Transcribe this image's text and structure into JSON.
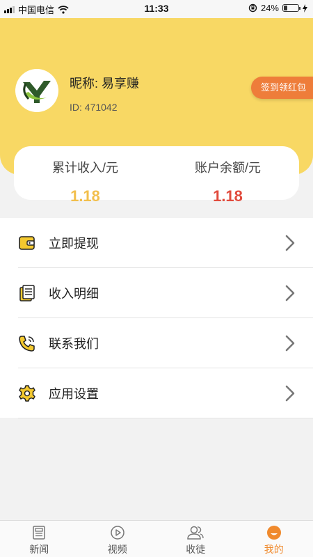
{
  "status_bar": {
    "carrier": "中国电信",
    "time": "11:33",
    "battery_percent": "24%",
    "battery_level": 0.24
  },
  "profile": {
    "nickname": "昵称: 易享赚",
    "id": "ID:   471042",
    "sign_button": "签到领红包"
  },
  "stats": {
    "total_income_label": "累计收入/元",
    "total_income_value": "1.18",
    "balance_label": "账户余额/元",
    "balance_value": "1.18"
  },
  "menu": [
    {
      "label": "立即提现",
      "icon": "wallet-icon"
    },
    {
      "label": "收入明细",
      "icon": "document-icon"
    },
    {
      "label": "联系我们",
      "icon": "phone-icon"
    },
    {
      "label": "应用设置",
      "icon": "gear-icon"
    }
  ],
  "tabs": [
    {
      "label": "新闻",
      "icon": "news-icon"
    },
    {
      "label": "视频",
      "icon": "play-icon"
    },
    {
      "label": "收徒",
      "icon": "users-icon"
    },
    {
      "label": "我的",
      "icon": "profile-icon",
      "active": true
    }
  ],
  "colors": {
    "header_yellow": "#f8d864",
    "accent_orange": "#ee7d3a",
    "income_gold": "#f2bf4c",
    "balance_red": "#e14b3d",
    "icon_yellow": "#f4c92f"
  }
}
